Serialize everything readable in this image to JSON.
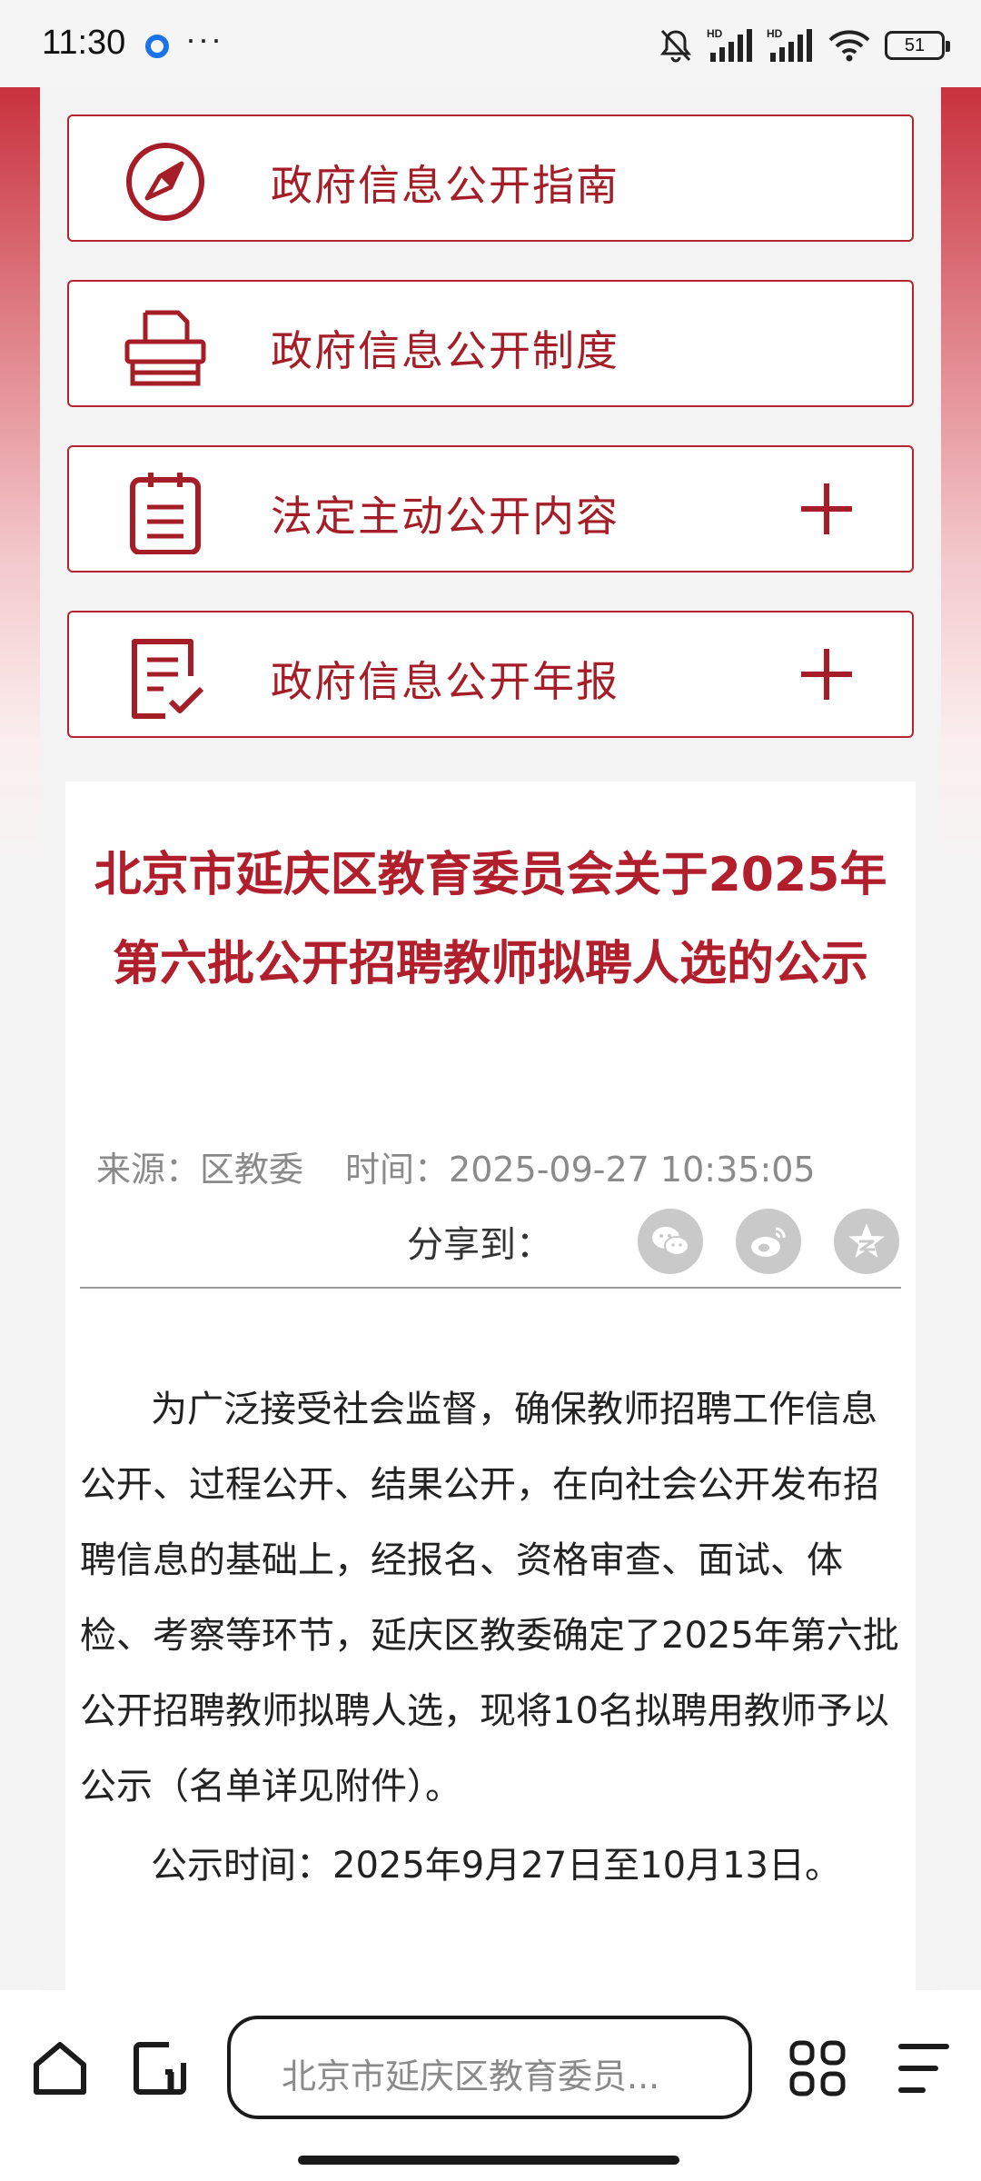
{
  "status_bar": {
    "time": "11:30",
    "more": "···",
    "battery": "51"
  },
  "nav_cards": [
    {
      "label": "政府信息公开指南",
      "icon": "compass-icon",
      "expandable": false
    },
    {
      "label": "政府信息公开制度",
      "icon": "printer-icon",
      "expandable": false
    },
    {
      "label": "法定主动公开内容",
      "icon": "clipboard-icon",
      "expandable": true
    },
    {
      "label": "政府信息公开年报",
      "icon": "report-check-icon",
      "expandable": true
    }
  ],
  "article": {
    "title": "北京市延庆区教育委员会关于2025年第六批公开招聘教师拟聘人选的公示",
    "source": "来源：区教委",
    "time": "时间：2025-09-27 10:35:05",
    "share_label": "分享到：",
    "share_targets": [
      "wechat-icon",
      "weibo-icon",
      "qzone-icon"
    ],
    "paragraphs": [
      "为广泛接受社会监督，确保教师招聘工作信息公开、过程公开、结果公开，在向社会公开发布招聘信息的基础上，经报名、资格审查、面试、体检、考察等环节，延庆区教委确定了2025年第六批公开招聘教师拟聘人选，现将10名拟聘用教师予以公示（名单详见附件）。",
      "公示时间：2025年9月27日至10月13日。"
    ]
  },
  "browser_bar": {
    "search_text": "北京市延庆区教育委员..."
  },
  "colors": {
    "brand_red": "#a51d27",
    "title_red": "#b01f2b",
    "meta_gray": "#8a8a8a"
  }
}
